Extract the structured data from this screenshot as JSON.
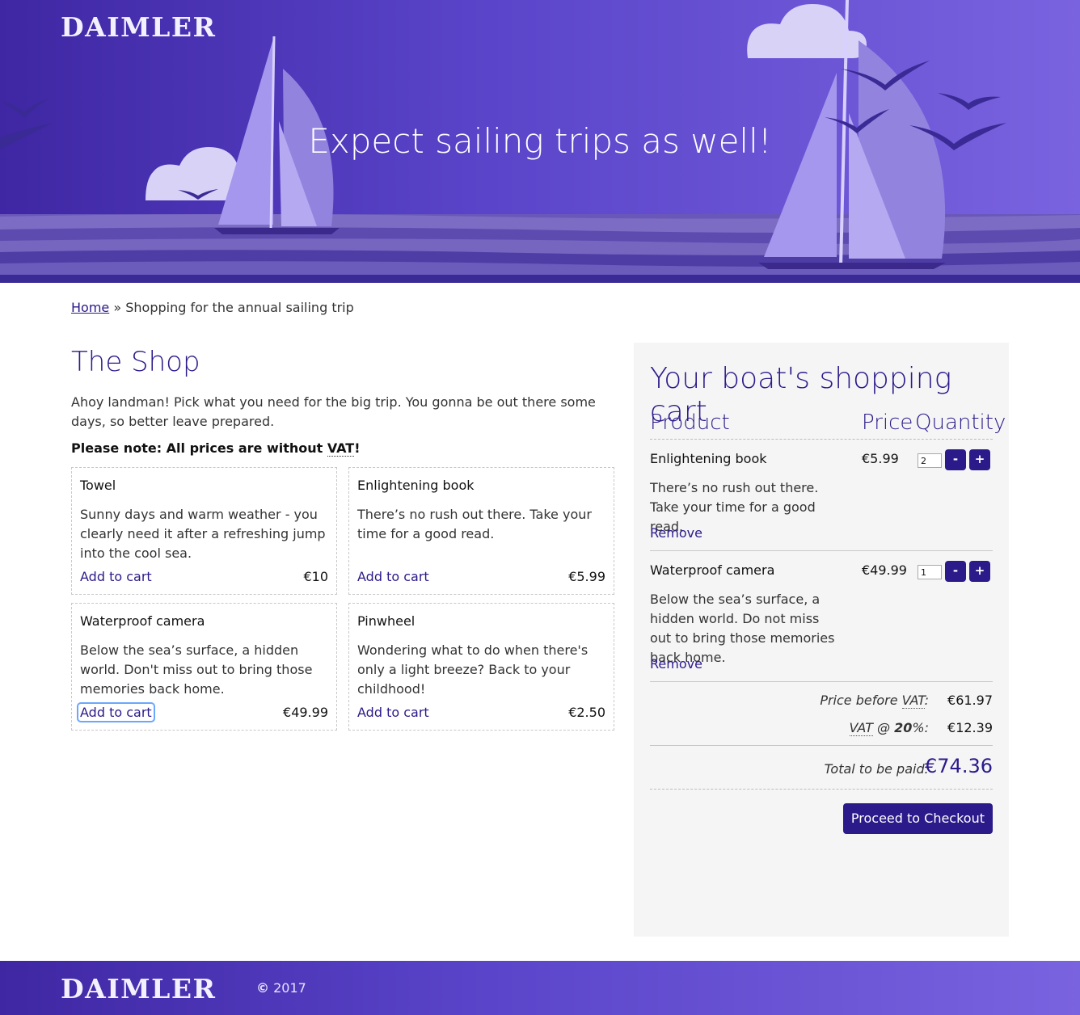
{
  "header": {
    "logo": "DAIMLER",
    "title": "Expect sailing trips as well!"
  },
  "breadcrumb": {
    "home": "Home",
    "separator": "»",
    "current": "Shopping for the annual sailing trip"
  },
  "shop": {
    "title": "The Shop",
    "intro": "Ahoy landman! Pick what you need for the big trip. You gonna be out there some days, so better leave prepared.",
    "note_prefix": "Please note: All prices are without ",
    "note_abbr": "VAT",
    "note_suffix": "!",
    "add_label": "Add to cart",
    "products": [
      {
        "name": "Towel",
        "description": "Sunny days and warm weather - you clearly need it after a refreshing jump into the cool sea.",
        "price": "€10"
      },
      {
        "name": "Enlightening book",
        "description": "There’s no rush out there. Take your time for a good read.",
        "price": "€5.99"
      },
      {
        "name": "Waterproof camera",
        "description": "Below the sea’s surface, a hidden world. Don't miss out to bring those memories back home.",
        "price": "€49.99"
      },
      {
        "name": "Pinwheel",
        "description": "Wondering what to do when there's only a light breeze? Back to your childhood!",
        "price": "€2.50"
      }
    ]
  },
  "cart": {
    "title": "Your boat's shopping cart",
    "columns": {
      "product": "Product",
      "price": "Price",
      "quantity": "Quantity"
    },
    "minus_label": "-",
    "plus_label": "+",
    "remove_label": "Remove",
    "items": [
      {
        "name": "Enlightening book",
        "price": "€5.99",
        "quantity": "2",
        "description": "There’s no rush out there. Take your time for a good read."
      },
      {
        "name": "Waterproof camera",
        "price": "€49.99",
        "quantity": "1",
        "description": "Below the sea’s surface, a hidden world. Do not miss out to bring those memories back home."
      }
    ],
    "summary": {
      "before_vat_prefix": "Price before ",
      "vat_abbr": "VAT",
      "colon": ":",
      "before_vat_value": "€61.97",
      "vat_at": " @ ",
      "vat_rate": "20",
      "vat_percent": "%:",
      "vat_value": "€12.39",
      "total_label": "Total to be paid:",
      "total_value": "€74.36"
    },
    "checkout_label": "Proceed to Checkout"
  },
  "footer": {
    "logo": "DAIMLER",
    "copyright_symbol": "©",
    "year": "2017"
  },
  "colors": {
    "brand": "#2b1a8a",
    "header_gradient_start": "#3f27a3",
    "header_gradient_end": "#7a63df",
    "cart_background": "#f5f5f5"
  }
}
